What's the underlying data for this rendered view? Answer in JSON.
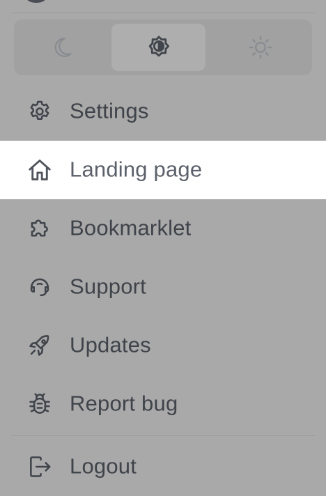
{
  "theme_switcher": {
    "options": [
      {
        "name": "dark",
        "icon": "moon-icon"
      },
      {
        "name": "system",
        "icon": "contrast-sun-icon",
        "selected": true
      },
      {
        "name": "light",
        "icon": "sun-icon"
      }
    ]
  },
  "menu": {
    "items": [
      {
        "label": "Settings",
        "icon": "gear-icon"
      },
      {
        "label": "Landing page",
        "icon": "home-icon",
        "active": true
      },
      {
        "label": "Bookmarklet",
        "icon": "puzzle-icon"
      },
      {
        "label": "Support",
        "icon": "headset-icon"
      },
      {
        "label": "Updates",
        "icon": "rocket-icon"
      },
      {
        "label": "Report bug",
        "icon": "bug-icon"
      }
    ],
    "logout": {
      "label": "Logout",
      "icon": "logout-icon"
    }
  },
  "colors": {
    "overlay_background": "#a9a9a9",
    "active_item_background": "#ffffff",
    "text": "#3f434a"
  }
}
